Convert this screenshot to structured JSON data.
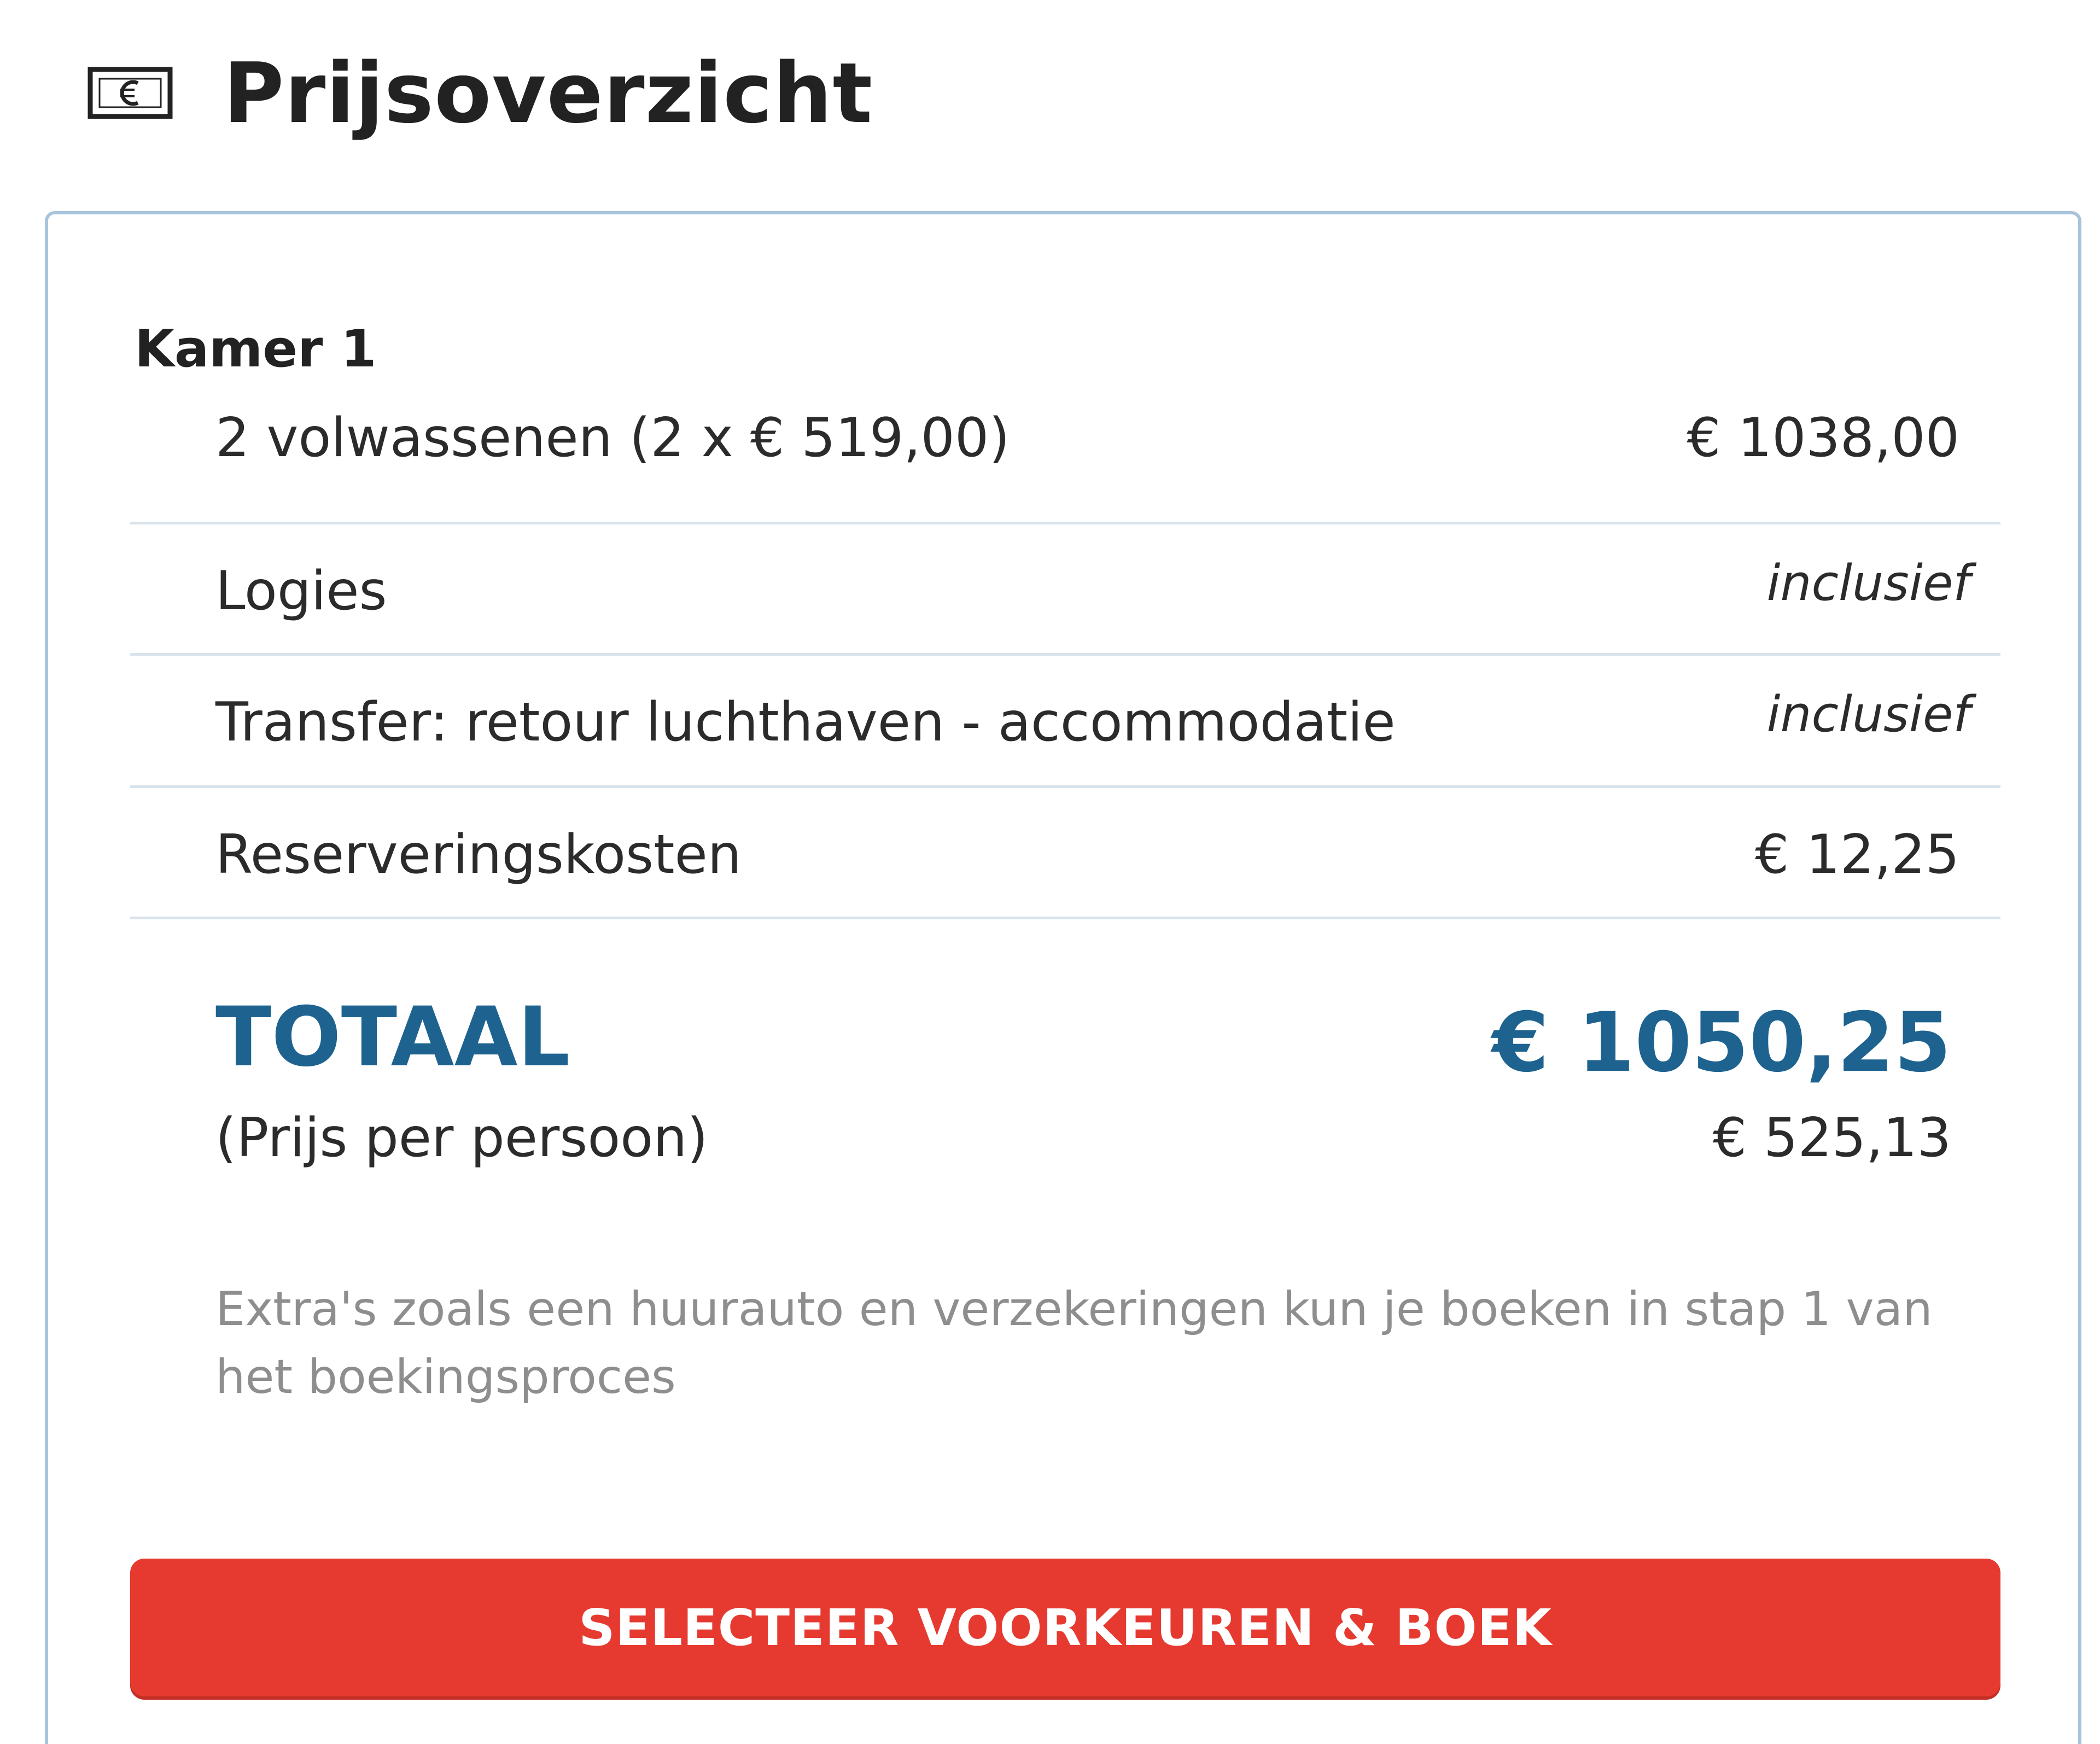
{
  "header": {
    "icon": "money-bill-icon",
    "title": "Prijsoverzicht"
  },
  "price_summary": {
    "room_label": "Kamer 1",
    "lines": [
      {
        "label": "2 volwassenen (2 x € 519,00)",
        "value": "€ 1038,00"
      },
      {
        "label": "Logies",
        "value": "inclusief"
      },
      {
        "label": "Transfer: retour luchthaven - accommodatie",
        "value": "inclusief"
      },
      {
        "label": "Reserveringskosten",
        "value": "€ 12,25"
      }
    ],
    "total_label": "TOTAAL",
    "total_value": "€ 1050,25",
    "per_person_label": "(Prijs per persoon)",
    "per_person_value": "€ 525,13",
    "note": "Extra's zoals een huurauto en verzekeringen kun je boeken in stap 1 van het boekingsproces",
    "book_button_label": "SELECTEER VOORKEUREN & BOEK"
  },
  "colors": {
    "accent_blue": "#1e6390",
    "button_red": "#e63a30",
    "card_border": "#a8c4dc"
  }
}
